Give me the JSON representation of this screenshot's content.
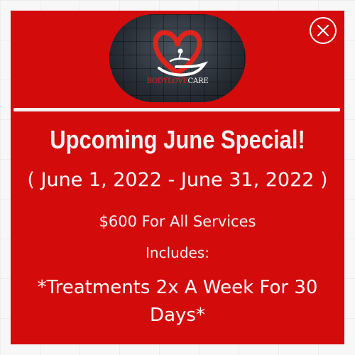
{
  "popup": {
    "brand": {
      "part1": "BODYLOVE",
      "part2": "CARE"
    },
    "title": "Upcoming June Special!",
    "date_range": "( June 1, 2022 - June 31, 2022 )",
    "price": "$600 For All Services",
    "includes_label": "Includes:",
    "treatment": "*Treatments 2x A Week For 30 Days*"
  },
  "colors": {
    "modal_background": "#d40b0b",
    "text": "#ffffff",
    "logo_heart": "#e0241b",
    "logo_background": "#2a3038"
  },
  "icons": {
    "close": "close-circle-icon",
    "logo": "heart-hand-massage-logo"
  }
}
